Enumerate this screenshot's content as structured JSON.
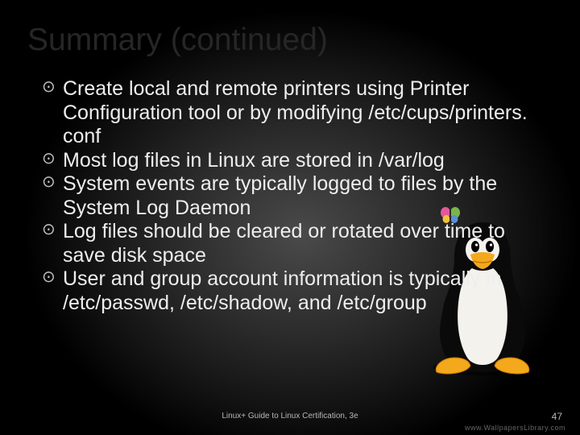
{
  "title": "Summary (continued)",
  "bullets": {
    "b0": "Create local and remote printers using Printer Configuration tool or by modifying /etc/cups/printers. conf",
    "b1": "Most log files in Linux are stored in /var/log",
    "b2": "System events are typically logged to files by the System Log Daemon",
    "b3": "Log files should be cleared or rotated over time to save disk space",
    "b4": "User and group account information is typically in /etc/passwd, /etc/shadow, and /etc/group"
  },
  "footer": "Linux+ Guide to Linux Certification, 3e",
  "page_number": "47",
  "watermark": "www.WallpapersLibrary.com"
}
